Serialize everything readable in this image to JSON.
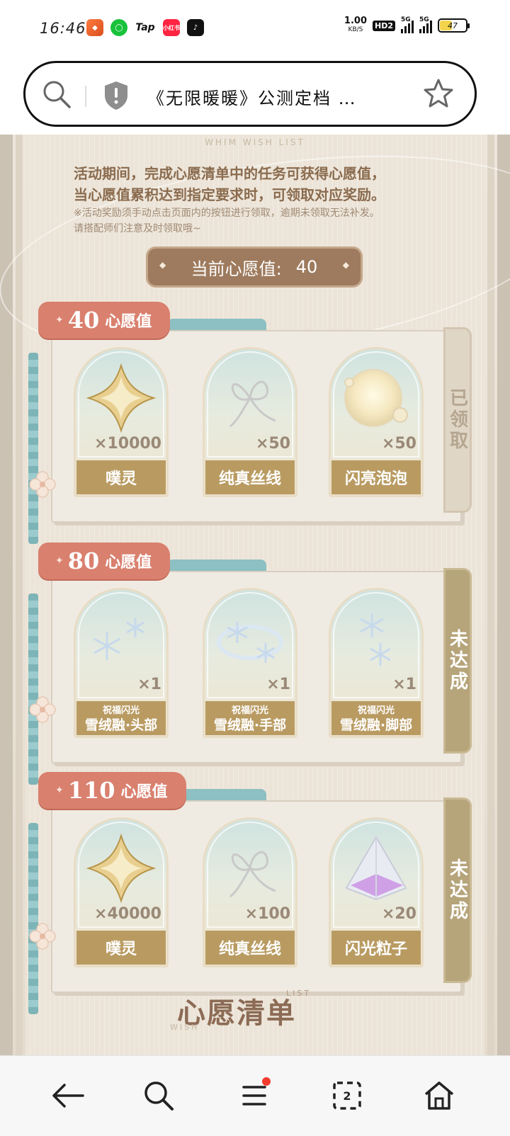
{
  "status_bar": {
    "time": "16:46",
    "apps": [
      "app-icon-1",
      "app-icon-2",
      "Tap",
      "小红书",
      "app-icon-5"
    ],
    "net_speed": "1.00",
    "net_unit": "KB/S",
    "hd": "HD2",
    "signal1": "5G",
    "signal2": "5G",
    "battery": "47"
  },
  "address_bar": {
    "url_text": "《无限暖暖》公测定档 …"
  },
  "page": {
    "header_tag": "WHIM WISH LIST",
    "desc_main": "活动期间，完成心愿清单中的任务可获得心愿值，\n当心愿值累积达到指定要求时，可领取对应奖励。",
    "desc_note": "※活动奖励须手动点击页面内的按钮进行领取，逾期未领取无法补发。\n请搭配师们注意及时领取哦~",
    "wish_label": "当前心愿值:",
    "wish_value": "40",
    "groups": [
      {
        "threshold": "40",
        "unit": "心愿值",
        "status": "已领取",
        "items": [
          {
            "qty": "×10000",
            "name": "噗灵"
          },
          {
            "qty": "×50",
            "name": "纯真丝线"
          },
          {
            "qty": "×50",
            "name": "闪亮泡泡"
          }
        ]
      },
      {
        "threshold": "80",
        "unit": "心愿值",
        "status": "未达成",
        "items": [
          {
            "qty": "×1",
            "sub": "祝福闪光",
            "name": "雪绒融·头部"
          },
          {
            "qty": "×1",
            "sub": "祝福闪光",
            "name": "雪绒融·手部"
          },
          {
            "qty": "×1",
            "sub": "祝福闪光",
            "name": "雪绒融·脚部"
          }
        ]
      },
      {
        "threshold": "110",
        "unit": "心愿值",
        "status": "未达成",
        "items": [
          {
            "qty": "×40000",
            "name": "噗灵"
          },
          {
            "qty": "×100",
            "name": "纯真丝线"
          },
          {
            "qty": "×20",
            "name": "闪光粒子"
          }
        ]
      }
    ],
    "footer_title": "心愿清单",
    "footer_list": "LIST",
    "footer_wish": "WISH"
  },
  "bottom_nav": {
    "tab_count": "2",
    "icons": [
      "back-icon",
      "search-icon",
      "menu-icon",
      "tabs-icon",
      "home-icon"
    ]
  },
  "colors": {
    "accent_pink": "#d9806e",
    "gold_label": "#b99b62",
    "pill_brown": "#9e7b5e",
    "teal": "#8cc0c2"
  }
}
